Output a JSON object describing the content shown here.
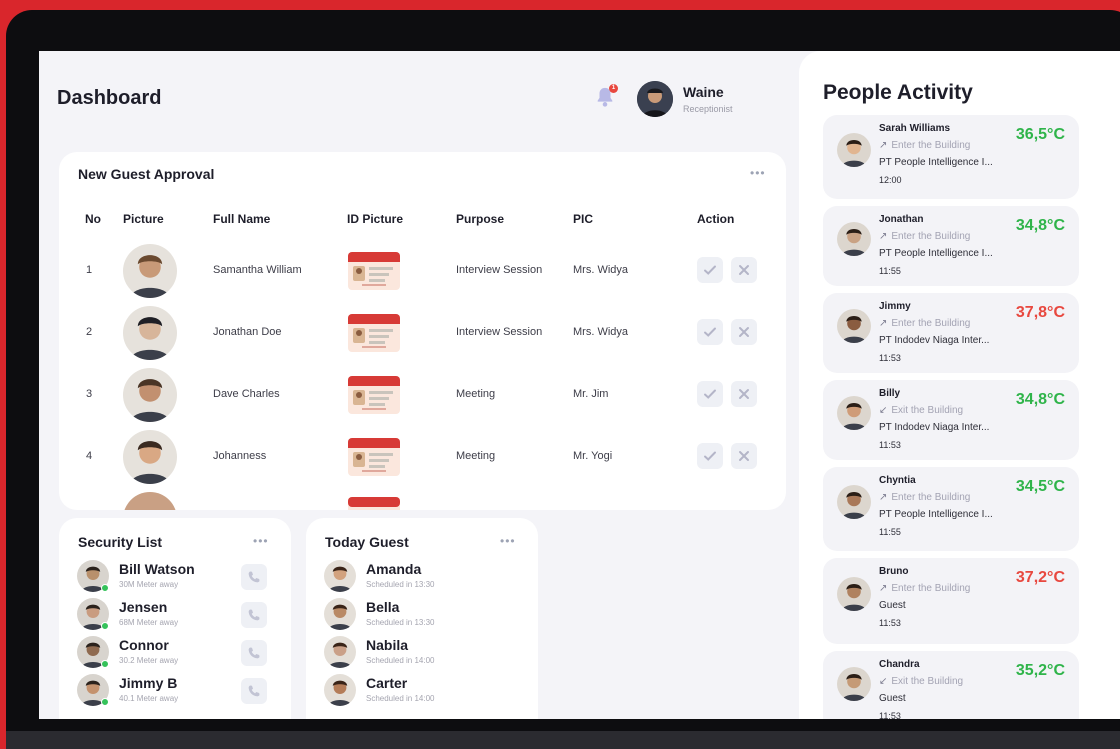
{
  "colors": {
    "ok": "#2fb44a",
    "alert": "#e8483f",
    "accent": "#b8b9e6"
  },
  "header": {
    "title": "Dashboard",
    "notification_count": "1",
    "user_name": "Waine",
    "user_role": "Receptionist"
  },
  "approval": {
    "title": "New Guest Approval",
    "columns": {
      "no": "No",
      "picture": "Picture",
      "full_name": "Full Name",
      "id_picture": "ID Picture",
      "purpose": "Purpose",
      "pic": "PIC",
      "action": "Action"
    },
    "rows": [
      {
        "no": "1",
        "name": "Samantha William",
        "purpose": "Interview Session",
        "pic": "Mrs. Widya",
        "skin": "#c89a78",
        "hair": "#6b4a30"
      },
      {
        "no": "2",
        "name": "Jonathan Doe",
        "purpose": "Interview Session",
        "pic": "Mrs. Widya",
        "skin": "#d7b59a",
        "hair": "#1f1f25"
      },
      {
        "no": "3",
        "name": "Dave Charles",
        "purpose": "Meeting",
        "pic": "Mr. Jim",
        "skin": "#c29070",
        "hair": "#4a3526"
      },
      {
        "no": "4",
        "name": "Johanness",
        "purpose": "Meeting",
        "pic": "Mr. Yogi",
        "skin": "#d9a884",
        "hair": "#3a2a20"
      }
    ]
  },
  "security": {
    "title": "Security List",
    "items": [
      {
        "name": "Bill Watson",
        "sub": "30M Meter away",
        "skin": "#b8906c"
      },
      {
        "name": "Jensen",
        "sub": "68M Meter away",
        "skin": "#c99c80"
      },
      {
        "name": "Connor",
        "sub": "30.2 Meter away",
        "skin": "#8f6a50"
      },
      {
        "name": "Jimmy B",
        "sub": "40.1 Meter away",
        "skin": "#c4926e"
      }
    ]
  },
  "today_guest": {
    "title": "Today Guest",
    "items": [
      {
        "name": "Amanda",
        "sub": "Scheduled in 13:30",
        "skin": "#d2a27e"
      },
      {
        "name": "Bella",
        "sub": "Scheduled in 13:30",
        "skin": "#b98a66"
      },
      {
        "name": "Nabila",
        "sub": "Scheduled in 14:00",
        "skin": "#caa088"
      },
      {
        "name": "Carter",
        "sub": "Scheduled in 14:00",
        "skin": "#b47c58"
      }
    ]
  },
  "activity": {
    "title": "People Activity",
    "people": [
      {
        "name": "Sarah Williams",
        "dir": "Enter the Building",
        "arrow": "↗",
        "org": "PT People Intelligence I...",
        "time": "12:00",
        "temp": "36,5°C",
        "status": "ok",
        "skin": "#e1b590"
      },
      {
        "name": "Jonathan",
        "dir": "Enter the Building",
        "arrow": "↗",
        "org": "PT People Intelligence I...",
        "time": "11:55",
        "temp": "34,8°C",
        "status": "ok",
        "skin": "#c9a284"
      },
      {
        "name": "Jimmy",
        "dir": "Enter the Building",
        "arrow": "↗",
        "org": "PT Indodev Niaga Inter...",
        "time": "11:53",
        "temp": "37,8°C",
        "status": "alert",
        "skin": "#8a5c40"
      },
      {
        "name": "Billy",
        "dir": "Exit the Building",
        "arrow": "↙",
        "org": "PT Indodev Niaga Inter...",
        "time": "11:53",
        "temp": "34,8°C",
        "status": "ok",
        "skin": "#cf9c78"
      },
      {
        "name": "Chyntia",
        "dir": "Enter the Building",
        "arrow": "↗",
        "org": "PT People Intelligence I...",
        "time": "11:55",
        "temp": "34,5°C",
        "status": "ok",
        "skin": "#a97858"
      },
      {
        "name": "Bruno",
        "dir": "Enter the Building",
        "arrow": "↗",
        "org": "Guest",
        "time": "11:53",
        "temp": "37,2°C",
        "status": "alert",
        "skin": "#b08260"
      },
      {
        "name": "Chandra",
        "dir": "Exit the Building",
        "arrow": "↙",
        "org": "Guest",
        "time": "11:53",
        "temp": "35,2°C",
        "status": "ok",
        "skin": "#c59a76"
      }
    ]
  }
}
